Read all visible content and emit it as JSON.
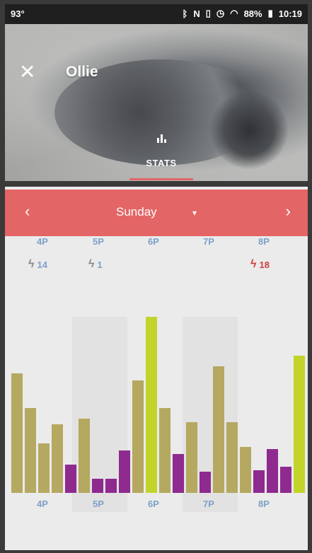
{
  "status_bar": {
    "temperature": "93°",
    "bluetooth_icon": "bluetooth-icon",
    "nfc_label": "N",
    "vibrate_icon": "vibrate-icon",
    "alarm_icon": "alarm-icon",
    "wifi_icon": "wifi-icon",
    "battery_percent": "88%",
    "time": "10:19"
  },
  "header": {
    "close_icon": "close-icon",
    "pet_name": "Ollie",
    "stats_tab_label": "STATS"
  },
  "day_selector": {
    "prev_label": "‹",
    "day": "Sunday",
    "dropdown_label": "▾",
    "next_label": "›"
  },
  "hour_labels": {
    "top": [
      "4P",
      "5P",
      "6P",
      "7P",
      "8P"
    ],
    "bottom": [
      "4P",
      "5P",
      "6P",
      "7P",
      "8P"
    ]
  },
  "activity_counts": [
    {
      "hour": "4P",
      "value": "14",
      "color": "#7ea0c8"
    },
    {
      "hour": "5P",
      "value": "1",
      "color": "#7ea0c8"
    },
    {
      "hour": "8P",
      "value": "18",
      "color": "#d23c3c"
    }
  ],
  "colors": {
    "accent": "#e46565",
    "olive": "#b5a860",
    "purple": "#8f2a8f",
    "lime": "#c2d42a",
    "hour_label": "#7ea0c8"
  },
  "chart_data": {
    "type": "bar",
    "categories": [
      "4P",
      "5P",
      "6P",
      "7P",
      "8P"
    ],
    "bars": [
      {
        "color": "olive",
        "value": 0.68
      },
      {
        "color": "olive",
        "value": 0.48
      },
      {
        "color": "olive",
        "value": 0.28
      },
      {
        "color": "olive",
        "value": 0.39
      },
      {
        "color": "purple",
        "value": 0.16
      },
      {
        "color": "olive",
        "value": 0.42
      },
      {
        "color": "purple",
        "value": 0.08
      },
      {
        "color": "purple",
        "value": 0.08
      },
      {
        "color": "purple",
        "value": 0.24
      },
      {
        "color": "olive",
        "value": 0.64
      },
      {
        "color": "lime",
        "value": 1.0
      },
      {
        "color": "olive",
        "value": 0.48
      },
      {
        "color": "purple",
        "value": 0.22
      },
      {
        "color": "olive",
        "value": 0.4
      },
      {
        "color": "purple",
        "value": 0.12
      },
      {
        "color": "olive",
        "value": 0.72
      },
      {
        "color": "olive",
        "value": 0.4
      },
      {
        "color": "olive",
        "value": 0.26
      },
      {
        "color": "purple",
        "value": 0.13
      },
      {
        "color": "purple",
        "value": 0.25
      },
      {
        "color": "purple",
        "value": 0.15
      },
      {
        "color": "lime",
        "value": 0.78
      }
    ]
  }
}
